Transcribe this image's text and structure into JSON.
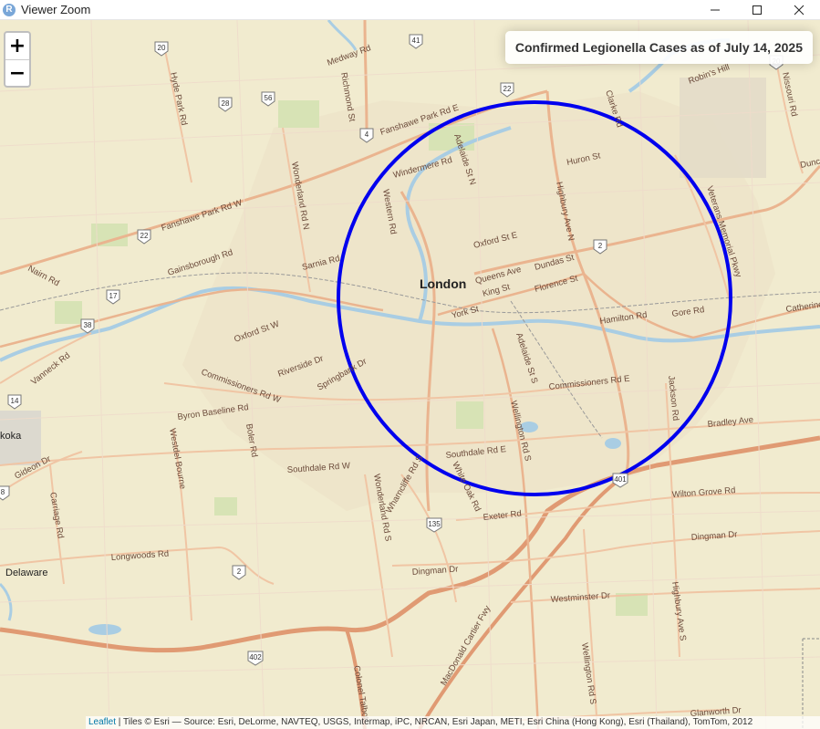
{
  "window": {
    "title": "Viewer Zoom",
    "app_icon_letter": "R"
  },
  "zoom": {
    "in_label": "+",
    "out_label": "−"
  },
  "info_box": {
    "title": "Confirmed Legionella Cases as of July 14, 2025"
  },
  "attribution": {
    "leaflet": "Leaflet",
    "text": " | Tiles © Esri — Source: Esri, DeLorme, NAVTEQ, USGS, Intermap, iPC, NRCAN, Esri Japan, METI, Esri China (Hong Kong), Esri (Thailand), TomTom, 2012"
  },
  "overlay": {
    "circle_color": "#0000ee"
  },
  "places": {
    "london": "London",
    "delaware": "Delaware",
    "koka": "koka"
  },
  "roads": {
    "medway": "Medway Rd",
    "richmond": "Richmond St",
    "fanshawe_e": "Fanshawe Park Rd E",
    "fanshawe_w": "Fanshawe Park Rd W",
    "hyde_park": "Hyde Park Rd",
    "wonderland_n": "Wonderland Rd N",
    "windermere": "Windermere Rd",
    "adelaide_n": "Adelaide St N",
    "huron": "Huron St",
    "highbury_n": "Highbury Ave N",
    "clarke": "Clarke Rd",
    "robins_hill": "Robin's Hill",
    "nissouri": "Nissouri Rd",
    "western": "Western Rd",
    "oxford_e": "Oxford St E",
    "oxford_w": "Oxford St W",
    "gainsborough": "Gainsborough Rd",
    "sarnia": "Sarnia Rd",
    "nairn": "Nairn Rd",
    "queens": "Queens Ave",
    "dundas": "Dundas St",
    "king": "King St",
    "york": "York St",
    "florence": "Florence St",
    "veterans": "Veterans Memorial Pkwy",
    "hamilton": "Hamilton Rd",
    "gore": "Gore Rd",
    "catherine": "Catherine",
    "riverside": "Riverside Dr",
    "springbank": "Springbank Dr",
    "commissioners_w": "Commissioners Rd W",
    "commissioners_e": "Commissioners Rd E",
    "adelaide_s": "Adelaide St S",
    "vanneck": "Vanneck Rd",
    "byron": "Byron Baseline Rd",
    "boler": "Boler Rd",
    "westdel": "Westdel Bourne",
    "wellington_s": "Wellington Rd S",
    "jackson": "Jackson Rd",
    "bradley": "Bradley Ave",
    "southdale_e": "Southdale Rd E",
    "southdale_w": "Southdale Rd W",
    "gideon": "Gideon Dr",
    "carriage": "Carriage Rd",
    "wharncliffe": "Wharncliffe Rd S",
    "white_oak": "White Oak Rd",
    "wonderland_s": "Wonderland Rd S",
    "exeter": "Exeter Rd",
    "wilton_grove": "Wilton Grove Rd",
    "dingman": "Dingman Dr",
    "longwoods": "Longwoods Rd",
    "westminster": "Westminster Dr",
    "highbury_s": "Highbury Ave S",
    "mcdonald": "MacDonald Cartier Fwy",
    "colonel_talbot": "Colonel Talbot",
    "glanworth": "Glanworth Dr",
    "dundas_far": "Dunc"
  },
  "shields": [
    "20",
    "41",
    "28",
    "56",
    "4",
    "22",
    "22",
    "2",
    "17",
    "38",
    "14",
    "135",
    "401",
    "2",
    "402",
    "8",
    "20"
  ]
}
